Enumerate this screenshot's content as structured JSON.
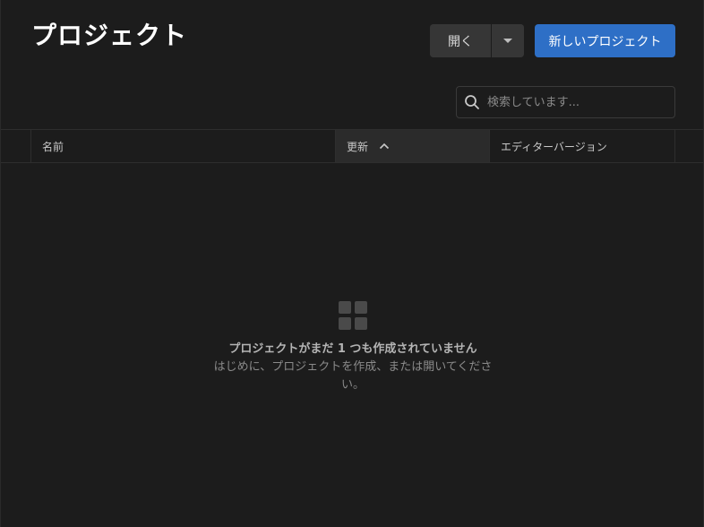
{
  "header": {
    "title": "プロジェクト",
    "open_label": "開く",
    "new_project_label": "新しいプロジェクト"
  },
  "search": {
    "placeholder": "検索しています...",
    "value": ""
  },
  "table": {
    "columns": [
      {
        "key": "name",
        "label": "名前"
      },
      {
        "key": "updated",
        "label": "更新",
        "sort": "ascending"
      },
      {
        "key": "editor_version",
        "label": "エディターバージョン"
      }
    ],
    "rows": []
  },
  "empty_state": {
    "icon": "grid-icon",
    "title": "プロジェクトがまだ 1 つも作成されていません",
    "description": "はじめに、プロジェクトを作成、または開いてください。"
  },
  "colors": {
    "background": "#1c1c1c",
    "accent": "#2e6fc6",
    "button": "#363636",
    "sorted_column": "#2b2b2b"
  }
}
